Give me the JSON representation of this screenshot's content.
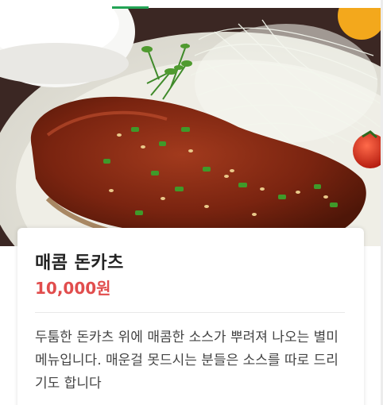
{
  "product": {
    "name": "매콤 돈카츠",
    "price": "10,000원",
    "description": "두툼한 돈카츠 위에 매콤한 소스가 뿌려져 나오는 별미 메뉴입니다. 매운걸 못드시는 분들은 소스를 따로 드리기도 합니다"
  },
  "image": {
    "subject": "spicy pork cutlet with shredded cabbage, cherry tomato and rice bowl",
    "icon": "food-photo"
  },
  "colors": {
    "accent_indicator": "#23a455",
    "price": "#e14d4d",
    "title": "#222222",
    "text": "#444444"
  }
}
